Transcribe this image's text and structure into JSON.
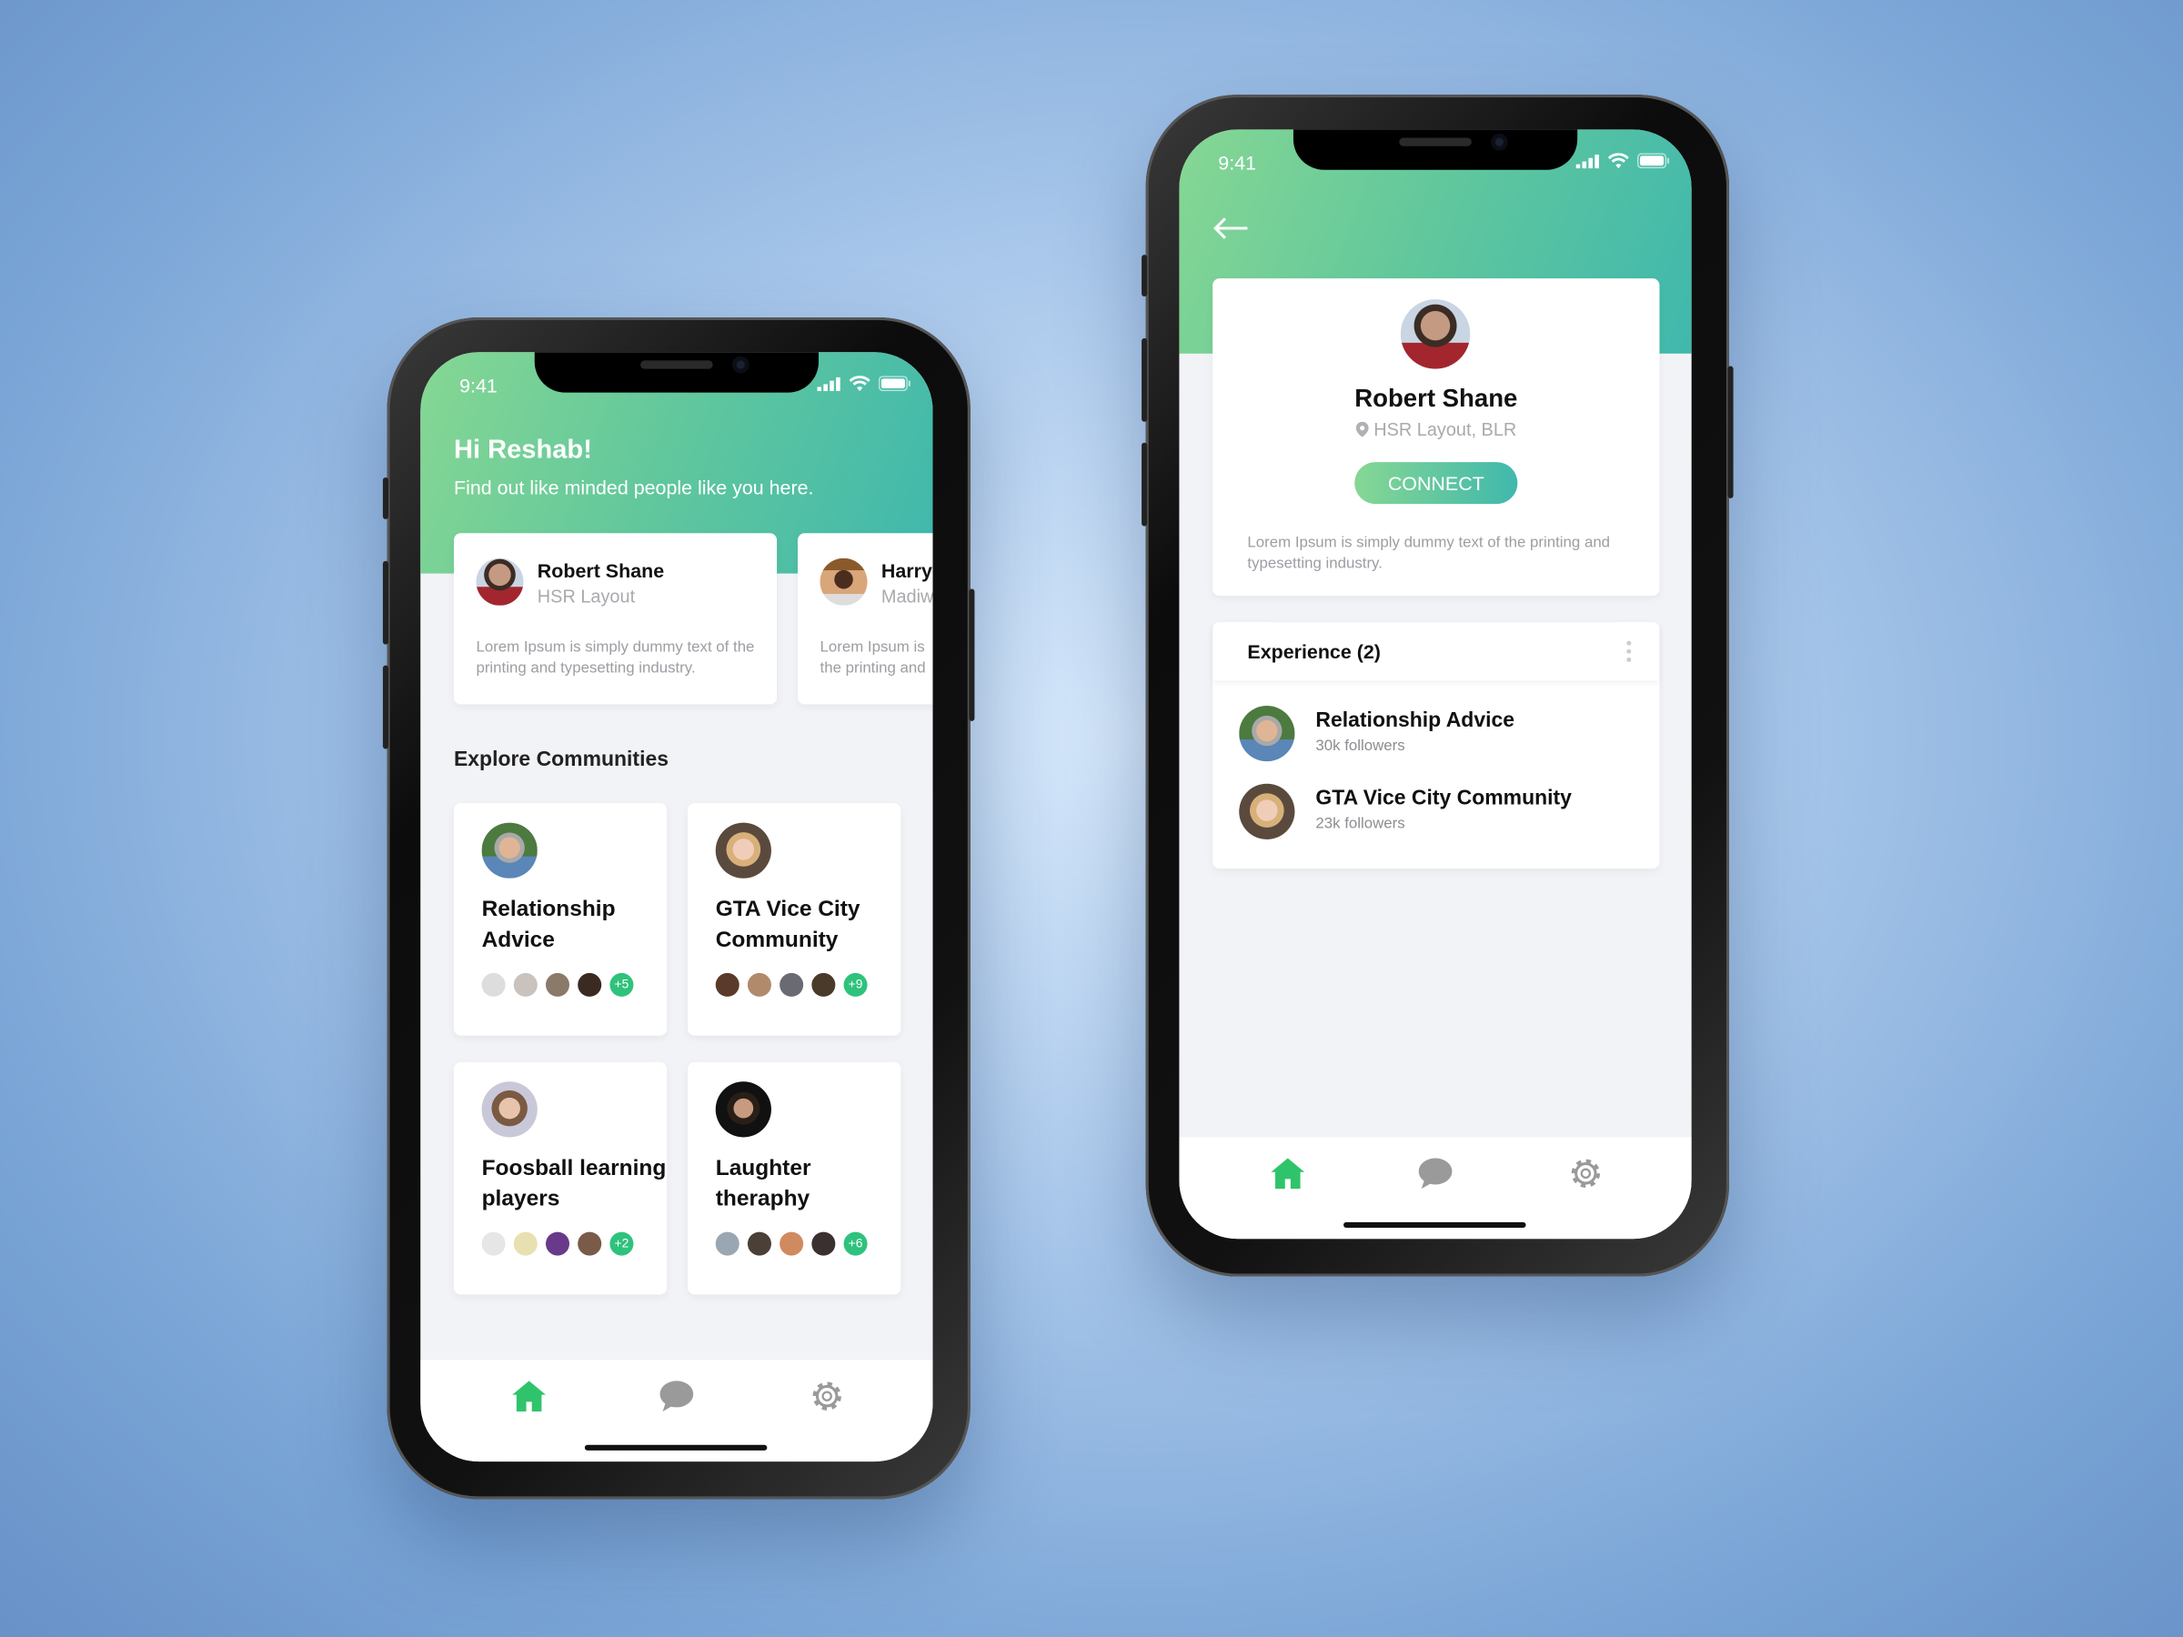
{
  "status_bar": {
    "time": "9:41"
  },
  "home_screen": {
    "greeting": "Hi Reshab!",
    "subtitle": "Find out like minded people like you here.",
    "people": [
      {
        "name": "Robert Shane",
        "location": "HSR Layout",
        "bio": "Lorem Ipsum is simply dummy text of the printing and typesetting industry."
      },
      {
        "name": "Harry",
        "location": "Madiw",
        "bio": "Lorem Ipsum is the printing and"
      }
    ],
    "section_title": "Explore Communities",
    "communities": [
      {
        "title_1": "Relationship",
        "title_2": "Advice",
        "extra": "+5"
      },
      {
        "title_1": "GTA Vice City",
        "title_2": "Community",
        "extra": "+9"
      },
      {
        "title_1": "Foosball learning",
        "title_2": "players",
        "extra": "+2"
      },
      {
        "title_1": "Laughter",
        "title_2": "theraphy",
        "extra": "+6"
      }
    ]
  },
  "profile_screen": {
    "name": "Robert Shane",
    "location": "HSR Layout, BLR",
    "connect_label": "CONNECT",
    "bio": "Lorem Ipsum is simply dummy text of the printing and typesetting industry.",
    "experience_title": "Experience (2)",
    "experience": [
      {
        "title": "Relationship Advice",
        "followers": "30k followers"
      },
      {
        "title": "GTA Vice City Community",
        "followers": "23k followers"
      }
    ]
  },
  "nav": {
    "items": [
      "home-icon",
      "chat-icon",
      "settings-icon"
    ],
    "active": "home-icon"
  },
  "colors": {
    "accent_start": "#86d793",
    "accent_end": "#40b8ad",
    "active_icon": "#2fc46b",
    "badge": "#2fc27c"
  }
}
